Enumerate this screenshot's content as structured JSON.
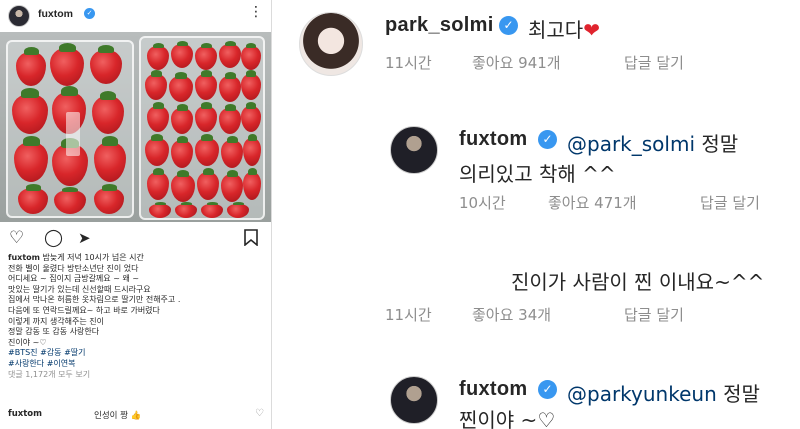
{
  "post": {
    "username": "fuxtom",
    "verified_icon": "verified-badge-icon",
    "more_icon": "more-options-icon",
    "photo_alt": "strawberry-photo",
    "actions": {
      "like": "heart-icon",
      "comment": "comment-icon",
      "share": "share-icon",
      "save": "bookmark-icon"
    },
    "caption_user": "fuxtom",
    "caption_lines": [
      "밤늦게 저녁 10시가 넘은 시간",
      "전화 벨이 울렸다  방탄소년단  진이 었다",
      "어디세요 ~  집이지  금방갈께요 ~  왜 ~",
      "맛있는 딸기가 있는데  신선할때 드시라구요",
      "집에서  막나온 허름한 옷차림으로 딸기만 전해주고 .",
      "다음에 또 연락드릴께요~ 하고  바로 가버렸다",
      "이렇게 까지  생각해주는 진이",
      "정말 감동 또 감동 사랑한다",
      "진이야 ~♡"
    ],
    "hashtags_line1": [
      "#BTS진",
      "#감동",
      "#딸기"
    ],
    "hashtags_line2": [
      "#사랑한다",
      "#이연복"
    ],
    "view_comments": "댓글 1,172개 모두 보기",
    "top_comment": {
      "user": "fuxtom",
      "text": "인성이 짱 👍",
      "like_icon": "heart-outline-icon"
    }
  },
  "thread": {
    "c1": {
      "user": "park_solmi",
      "text": "최고다",
      "emoji": "❤",
      "time": "11시간",
      "likes": "좋아요 941개",
      "reply": "답글 달기"
    },
    "c2": {
      "user": "fuxtom",
      "mention": "@park_solmi",
      "text_after_mention": " 정말",
      "text_line2": "의리있고 착해 ^^",
      "time": "10시간",
      "likes": "좋아요 471개",
      "reply": "답글 달기"
    },
    "c3": {
      "text": "진이가 사람이 찐 이내요~^^",
      "time": "11시간",
      "likes": "좋아요 34개",
      "reply": "답글 달기"
    },
    "c4": {
      "user": "fuxtom",
      "mention": "@parkyunkeun",
      "text_after_mention": " 정말",
      "text_line2": "찐이야 ~♡"
    }
  },
  "colors": {
    "verified": "#3897f0",
    "mention": "#00376b",
    "meta_gray": "#8e8e8e",
    "heart_red": "#e0242e"
  }
}
